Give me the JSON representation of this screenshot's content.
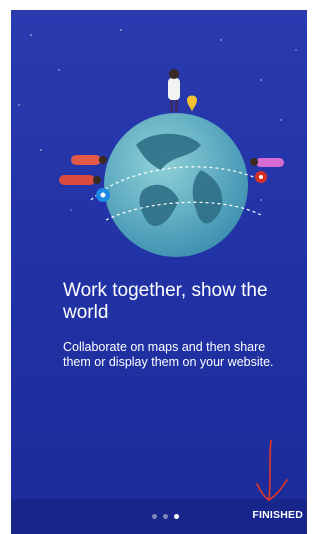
{
  "onboarding": {
    "title": "Work together, show the world",
    "description": "Collaborate on maps and then share them or display them on your website.",
    "page_indicator": {
      "count": 3,
      "active_index": 2
    },
    "finish_label": "FINISHED"
  },
  "colors": {
    "background": "#2233a6",
    "bottom_bar": "#18258a",
    "text": "#ffffff",
    "annotation_arrow": "#d9362b"
  },
  "icons": [
    "globe-illustration",
    "pin-icon",
    "down-arrow-annotation"
  ]
}
